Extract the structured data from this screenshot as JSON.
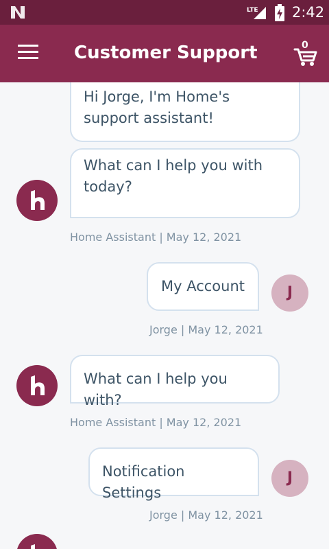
{
  "status_bar": {
    "network": "LTE",
    "time": "2:42"
  },
  "app_bar": {
    "title": "Customer Support",
    "cart_count": "0"
  },
  "messages": [
    {
      "sender": "bot",
      "text": "Hi Jorge, I'm Home's support assistant!"
    },
    {
      "sender": "bot",
      "text": "What can I help you with today?",
      "meta": "Home Assistant | May 12, 2021"
    },
    {
      "sender": "user",
      "text": "My Account",
      "avatar": "J",
      "meta": "Jorge | May 12, 2021"
    },
    {
      "sender": "bot",
      "text": "What can I help you with?",
      "meta": "Home Assistant | May 12, 2021"
    },
    {
      "sender": "user",
      "text": "Notification Settings",
      "avatar": "J",
      "meta": "Jorge | May 12, 2021"
    }
  ],
  "colors": {
    "status_bar": "#6a1f3d",
    "app_bar": "#8a2a4f",
    "bubble_border": "#d4e1ee",
    "user_avatar": "#d6b2c0"
  }
}
